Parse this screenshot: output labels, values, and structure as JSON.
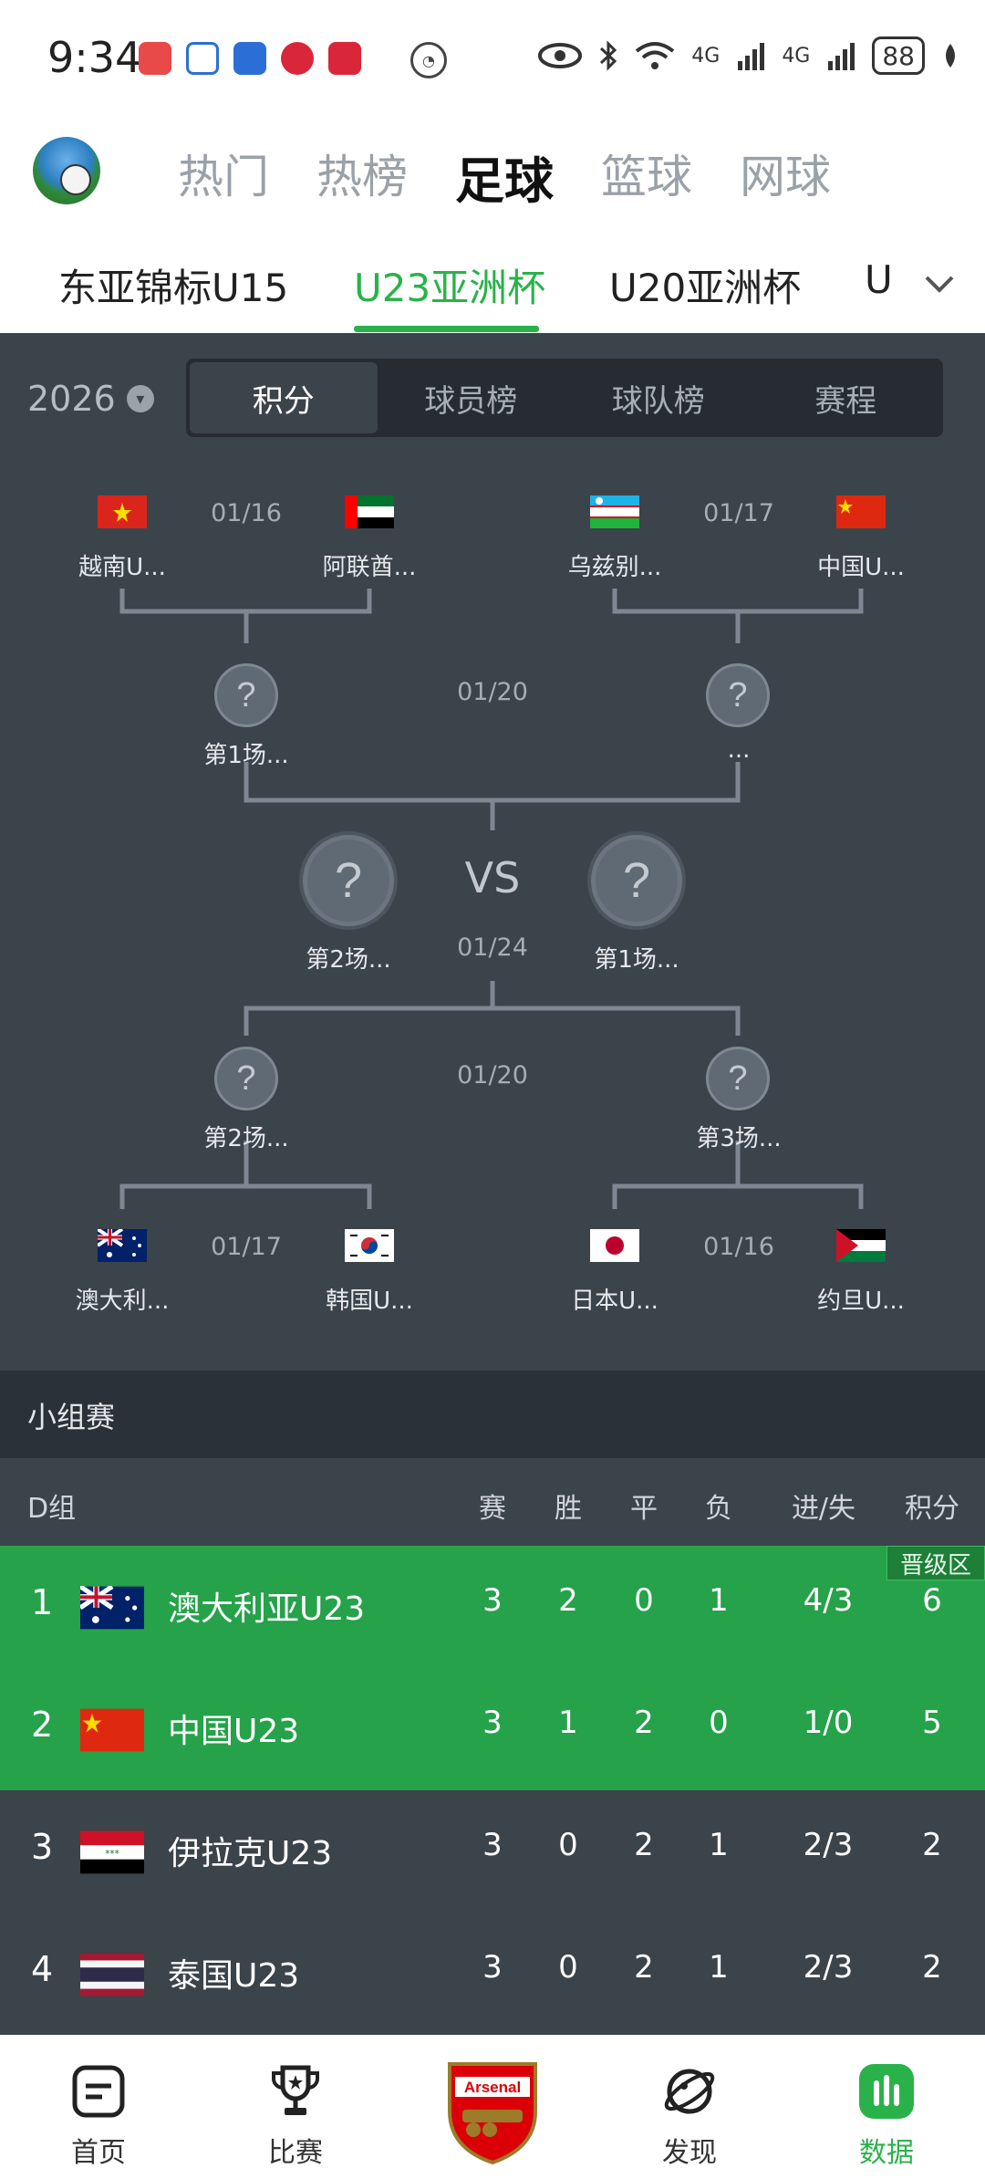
{
  "status_bar": {
    "time": "9:34",
    "battery": "88",
    "network_1": "4G",
    "network_2": "4G"
  },
  "top_nav": {
    "tabs": [
      {
        "label": "热门",
        "active": false
      },
      {
        "label": "热榜",
        "active": false
      },
      {
        "label": "足球",
        "active": true
      },
      {
        "label": "篮球",
        "active": false
      },
      {
        "label": "网球",
        "active": false
      }
    ]
  },
  "sub_tabs": [
    {
      "label": "东亚锦标U15",
      "active": false
    },
    {
      "label": "U23亚洲杯",
      "active": true
    },
    {
      "label": "U20亚洲杯",
      "active": false
    },
    {
      "label": "U",
      "active": false
    }
  ],
  "year_selector": "2026",
  "segment_tabs": [
    {
      "label": "积分",
      "active": true
    },
    {
      "label": "球员榜",
      "active": false
    },
    {
      "label": "球队榜",
      "active": false
    },
    {
      "label": "赛程",
      "active": false
    }
  ],
  "bracket": {
    "quarter_top_left": {
      "date": "01/16",
      "team_a": "越南U...",
      "team_b": "阿联酋..."
    },
    "quarter_top_right": {
      "date": "01/17",
      "team_a": "乌兹别...",
      "team_b": "中国U..."
    },
    "semi_top": {
      "date": "01/20",
      "left_label": "第1场...",
      "right_label": "..."
    },
    "final": {
      "date": "01/24",
      "vs": "VS",
      "left_label": "第2场...",
      "right_label": "第1场..."
    },
    "semi_bottom": {
      "date": "01/20",
      "left_label": "第2场...",
      "right_label": "第3场..."
    },
    "quarter_bottom_left": {
      "date": "01/17",
      "team_a": "澳大利...",
      "team_b": "韩国U..."
    },
    "quarter_bottom_right": {
      "date": "01/16",
      "team_a": "日本U...",
      "team_b": "约旦U..."
    },
    "question_mark": "?"
  },
  "group_stage": {
    "title": "小组赛",
    "group_name": "D组",
    "columns": [
      "赛",
      "胜",
      "平",
      "负",
      "进/失",
      "积分"
    ],
    "advance_badge": "晋级区",
    "rows": [
      {
        "rank": "1",
        "team": "澳大利亚U23",
        "played": "3",
        "win": "2",
        "draw": "0",
        "loss": "1",
        "goals": "4/3",
        "points": "6"
      },
      {
        "rank": "2",
        "team": "中国U23",
        "played": "3",
        "win": "1",
        "draw": "2",
        "loss": "0",
        "goals": "1/0",
        "points": "5"
      },
      {
        "rank": "3",
        "team": "伊拉克U23",
        "played": "3",
        "win": "0",
        "draw": "2",
        "loss": "1",
        "goals": "2/3",
        "points": "2"
      },
      {
        "rank": "4",
        "team": "泰国U23",
        "played": "3",
        "win": "0",
        "draw": "2",
        "loss": "1",
        "goals": "2/3",
        "points": "2"
      }
    ]
  },
  "bottom_nav": [
    {
      "label": "首页",
      "icon": "home-icon",
      "active": false
    },
    {
      "label": "比赛",
      "icon": "trophy-icon",
      "active": false
    },
    {
      "label": "",
      "icon": "arsenal-crest-icon",
      "active": false
    },
    {
      "label": "发现",
      "icon": "planet-icon",
      "active": false
    },
    {
      "label": "数据",
      "icon": "bar-chart-icon",
      "active": true
    }
  ],
  "crest_text": "Arsenal",
  "colors": {
    "accent": "#2ab24a",
    "dark_bg": "#3b434b",
    "row_green": "#25a24a"
  }
}
